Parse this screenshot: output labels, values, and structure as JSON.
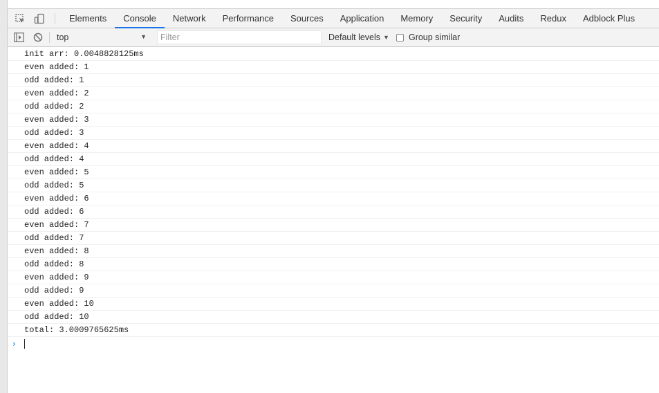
{
  "tabs": [
    {
      "label": "Elements",
      "active": false
    },
    {
      "label": "Console",
      "active": true
    },
    {
      "label": "Network",
      "active": false
    },
    {
      "label": "Performance",
      "active": false
    },
    {
      "label": "Sources",
      "active": false
    },
    {
      "label": "Application",
      "active": false
    },
    {
      "label": "Memory",
      "active": false
    },
    {
      "label": "Security",
      "active": false
    },
    {
      "label": "Audits",
      "active": false
    },
    {
      "label": "Redux",
      "active": false
    },
    {
      "label": "Adblock Plus",
      "active": false
    }
  ],
  "toolbar": {
    "context": "top",
    "filter_placeholder": "Filter",
    "levels_label": "Default levels",
    "group_similar_label": "Group similar",
    "group_similar_checked": false
  },
  "console": {
    "lines": [
      "init arr: 0.0048828125ms",
      "even added: 1",
      "odd added: 1",
      "even added: 2",
      "odd added: 2",
      "even added: 3",
      "odd added: 3",
      "even added: 4",
      "odd added: 4",
      "even added: 5",
      "odd added: 5",
      "even added: 6",
      "odd added: 6",
      "even added: 7",
      "odd added: 7",
      "even added: 8",
      "odd added: 8",
      "even added: 9",
      "odd added: 9",
      "even added: 10",
      "odd added: 10",
      "total: 3.0009765625ms"
    ],
    "prompt_symbol": "›"
  },
  "colors": {
    "accent": "#1a73e8",
    "toolbar_bg": "#f3f3f3",
    "border": "#cccccc"
  },
  "icons": {
    "inspect": "inspect-element-icon",
    "device": "device-toolbar-icon",
    "sidebar": "console-sidebar-icon",
    "clear": "clear-console-icon"
  }
}
